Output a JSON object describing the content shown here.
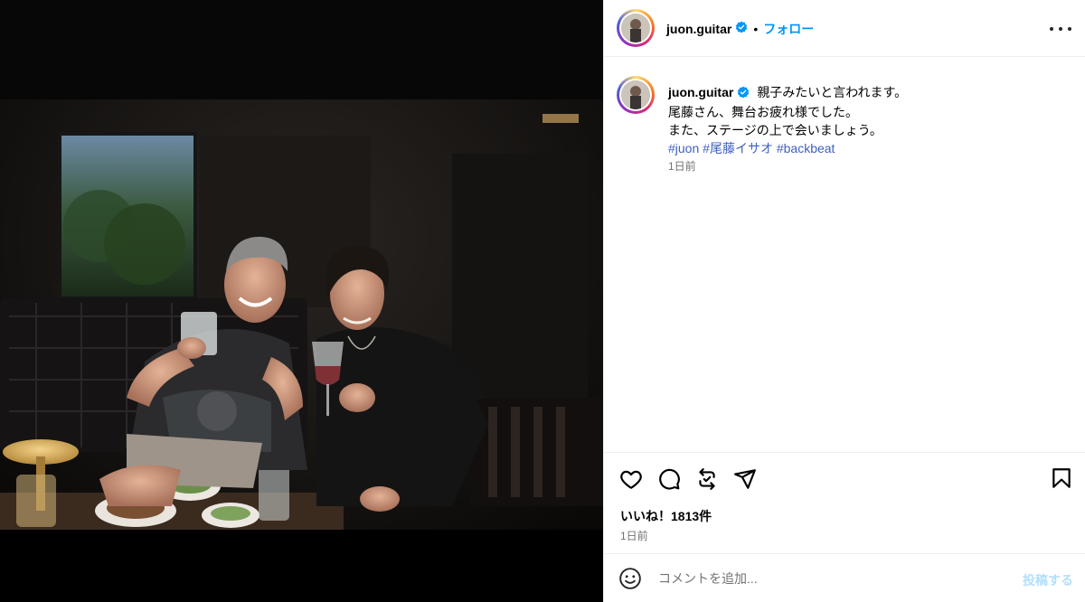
{
  "post": {
    "username": "juon.guitar",
    "verified": true,
    "follow_label": "フォロー",
    "more_icon": "more-horizontal-icon"
  },
  "caption": {
    "username": "juon.guitar",
    "line1": "親子みたいと言われます。",
    "line2": "尾藤さん、舞台お疲れ様でした。",
    "line3": "また、ステージの上で会いましょう。",
    "hashtags": [
      "#juon",
      "#尾藤イサオ",
      "#backbeat"
    ],
    "time": "1日前"
  },
  "actions": {
    "icons": [
      "heart-icon",
      "comment-icon",
      "repost-icon",
      "share-icon",
      "bookmark-icon"
    ]
  },
  "likes": "いいね！1813件",
  "time": "1日前",
  "comment": {
    "placeholder": "コメントを追加...",
    "post_label": "投稿する",
    "emoji_icon": "emoji-icon"
  },
  "colors": {
    "accent": "#0095f6",
    "hashtag": "#3f5fbf",
    "muted": "#737373",
    "post_disabled": "#b2dffc"
  }
}
